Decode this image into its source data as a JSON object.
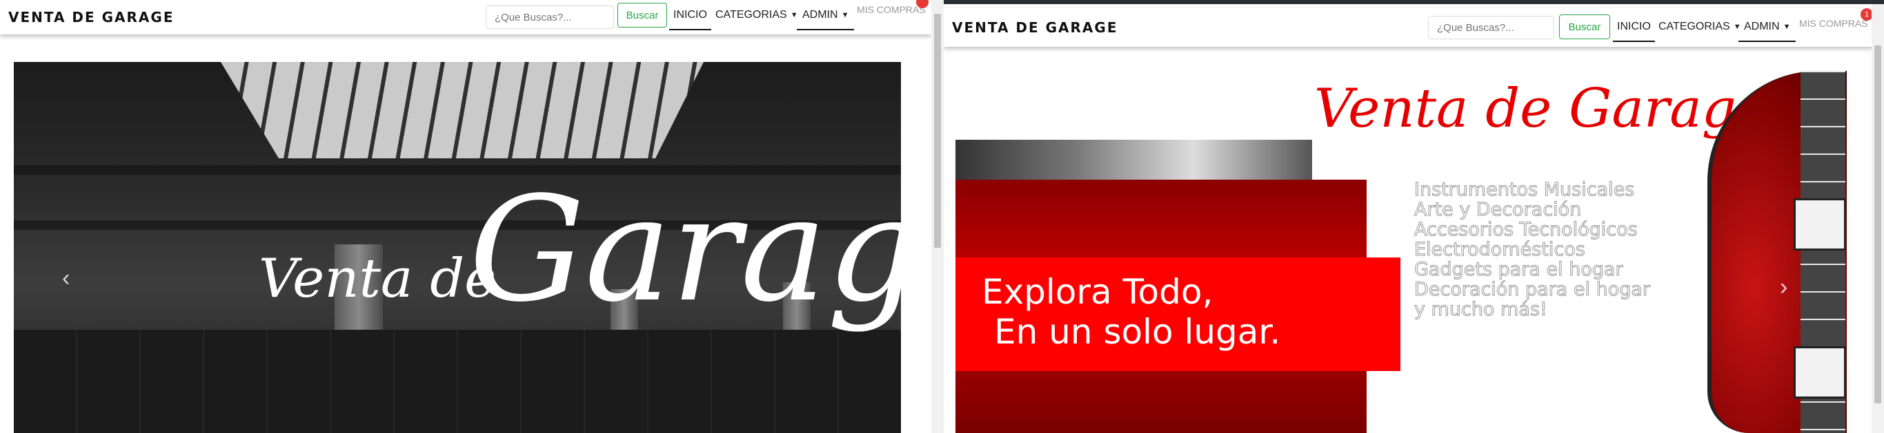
{
  "left": {
    "navbar": {
      "brand": "VENTA DE GARAGE",
      "search_placeholder": "¿Que Buscas?...",
      "search_button": "Buscar",
      "links": {
        "inicio": "INICIO",
        "categorias": "CATEGORIAS",
        "admin": "ADMIN"
      },
      "mis_compras": "MIS COMPRAS"
    },
    "slide": {
      "script_small": "Venta de",
      "script_large": "Garage"
    }
  },
  "right": {
    "navbar": {
      "brand": "VENTA DE GARAGE",
      "search_placeholder": "¿Que Buscas?...",
      "search_button": "Buscar",
      "links": {
        "inicio": "INICIO",
        "categorias": "CATEGORIAS",
        "admin": "ADMIN"
      },
      "mis_compras": "MIS COMPRAS",
      "cart_badge": "1"
    },
    "slide": {
      "title": "Venta de Garage",
      "features": [
        "Instrumentos Musicales",
        "Arte y Decoración",
        "Accesorios Tecnológicos",
        "Electrodomésticos",
        "Gadgets para el hogar",
        "Decoración para el hogar",
        "y mucho más!"
      ],
      "banner_line1": "Explora Todo,",
      "banner_line2": "En un solo lugar."
    }
  },
  "colors": {
    "accent_green": "#28a745",
    "brand_red": "#ff0000",
    "badge_red": "#e53935"
  }
}
